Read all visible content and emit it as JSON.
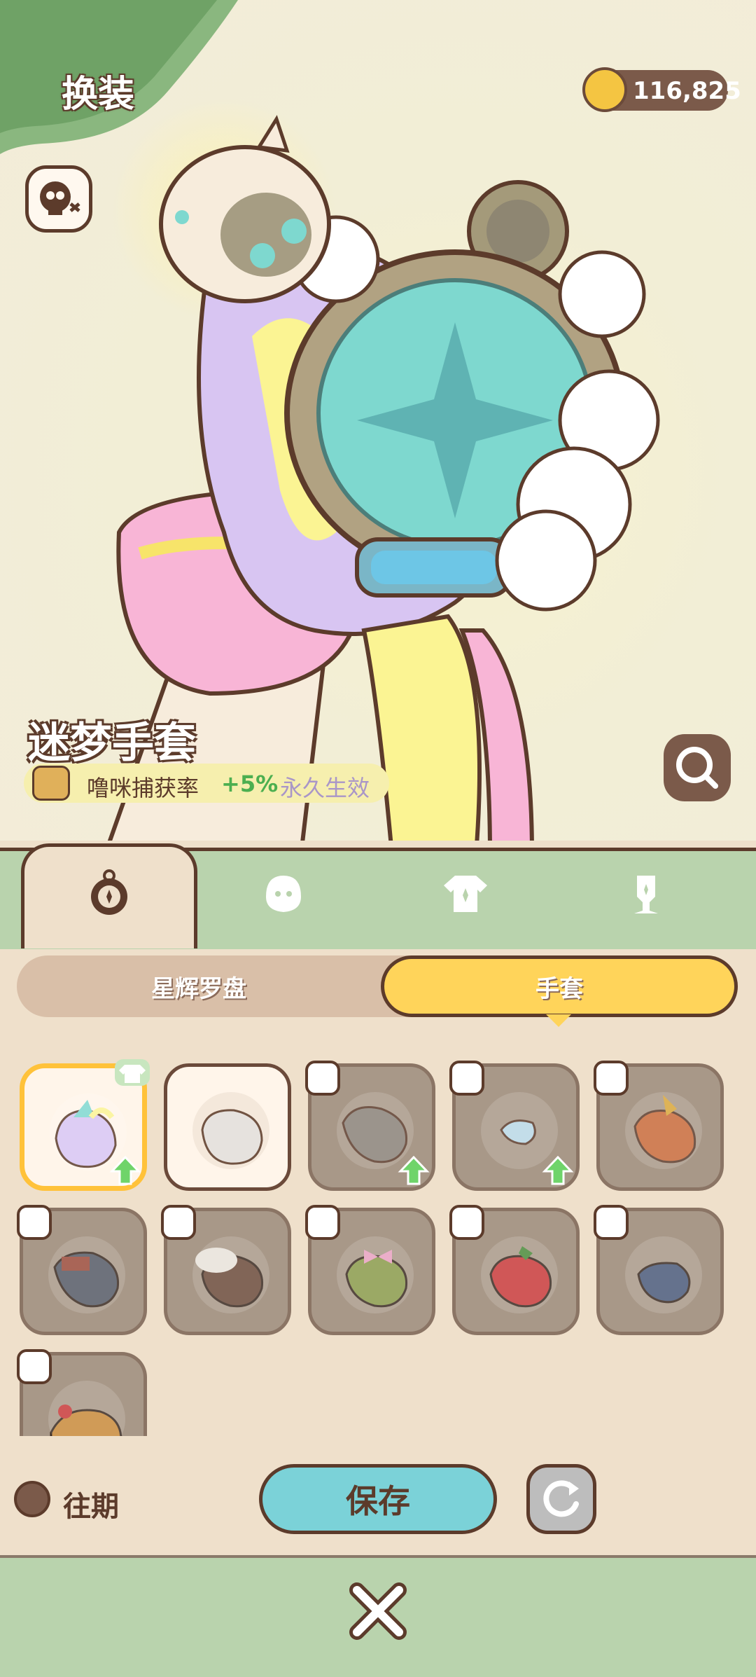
{
  "header": {
    "title": "换装",
    "coins": "116,825"
  },
  "preview": {
    "item_name": "迷梦手套",
    "effect_label": "噜咪捕获率",
    "effect_value": "+5%",
    "effect_duration": "永久生效"
  },
  "tabs": [
    {
      "icon": "compass-icon"
    },
    {
      "icon": "ghost-icon"
    },
    {
      "icon": "shirt-icon"
    },
    {
      "icon": "mannequin-icon"
    }
  ],
  "segments": {
    "left": "星辉罗盘",
    "right": "手套"
  },
  "footer": {
    "history_label": "往期",
    "save_label": "保存"
  },
  "colors": {
    "accent_yellow": "#ffd45a",
    "save_teal": "#7bd2d8",
    "tab_green": "#b9d3ad",
    "panel_bg": "#efe0cb",
    "outline_brown": "#5c3b2b"
  }
}
